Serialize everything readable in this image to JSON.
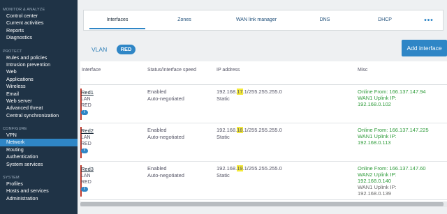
{
  "sidebar": {
    "sections": [
      {
        "title": "MONITOR & ANALYZE",
        "items": [
          "Control center",
          "Current activities",
          "Reports",
          "Diagnostics"
        ]
      },
      {
        "title": "PROTECT",
        "items": [
          "Rules and policies",
          "Intrusion prevention",
          "Web",
          "Applications",
          "Wireless",
          "Email",
          "Web server",
          "Advanced threat",
          "Central synchronization"
        ]
      },
      {
        "title": "CONFIGURE",
        "items": [
          "VPN",
          "Network",
          "Routing",
          "Authentication",
          "System services"
        ]
      },
      {
        "title": "SYSTEM",
        "items": [
          "Profiles",
          "Hosts and services",
          "Administration"
        ]
      }
    ],
    "active_item": "Network"
  },
  "tabs": [
    "Interfaces",
    "Zones",
    "WAN link manager",
    "DNS",
    "DHCP"
  ],
  "tabs_more": "•••",
  "active_tab": "Interfaces",
  "subtabs": {
    "vlan": "VLAN",
    "red": "RED"
  },
  "add_button": "Add interface",
  "table": {
    "headers": {
      "interface": "Interface",
      "status": "Status/Interface speed",
      "ip": "IP address",
      "misc": "Misc"
    },
    "rows": [
      {
        "name": "Red1",
        "zone": "LAN",
        "color": "RED",
        "info": "i",
        "status": "Enabled",
        "speed": "Auto-negotiated",
        "ip_prefix": "192.168.",
        "ip_highlight": "17",
        "ip_suffix": ".1/255.255.255.0",
        "ip_type": "Static",
        "misc": [
          {
            "text": "Online From: 166.137.147.94",
            "style": "green"
          },
          {
            "text": "WAN1 Uplink IP:",
            "style": "green"
          },
          {
            "text": "192.168.0.102",
            "style": "green"
          }
        ]
      },
      {
        "name": "Red2",
        "zone": "LAN",
        "color": "RED",
        "info": "i",
        "status": "Enabled",
        "speed": "Auto-negotiated",
        "ip_prefix": "192.168.",
        "ip_highlight": "18",
        "ip_suffix": ".1/255.255.255.0",
        "ip_type": "Static",
        "misc": [
          {
            "text": "Online From: 166.137.147.225",
            "style": "green"
          },
          {
            "text": "WAN1 Uplink IP:",
            "style": "green"
          },
          {
            "text": "192.168.0.113",
            "style": "green"
          }
        ]
      },
      {
        "name": "Red3",
        "zone": "LAN",
        "color": "RED",
        "info": "i",
        "status": "Enabled",
        "speed": "Auto-negotiated",
        "ip_prefix": "192.168.",
        "ip_highlight": "19",
        "ip_suffix": ".1/255.255.255.0",
        "ip_type": "Static",
        "misc": [
          {
            "text": "Online From: 166.137.147.60",
            "style": "green"
          },
          {
            "text": "WAN2 Uplink IP:",
            "style": "green"
          },
          {
            "text": "192.168.0.140",
            "style": "green"
          },
          {
            "text": "WAN1 Uplink IP:",
            "style": "dim"
          },
          {
            "text": "192.168.0.139",
            "style": "dim"
          }
        ]
      }
    ]
  },
  "colors": {
    "sidebar_bg": "#1f3346",
    "accent": "#2f86c6",
    "online_green": "#2e9b3a",
    "highlight": "#f5ea3a",
    "row_marker": "#c0392b"
  }
}
